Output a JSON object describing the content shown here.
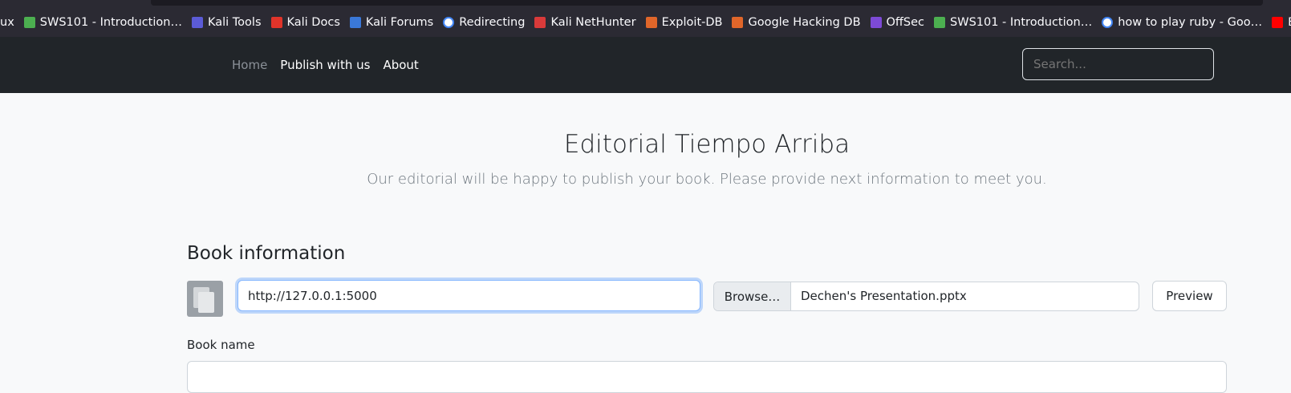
{
  "bookmarks": [
    {
      "label": "ux",
      "icon": "linux-icon",
      "color": "#2b2a33"
    },
    {
      "label": "SWS101 - Introduction…",
      "icon": "sws-icon",
      "color": "#4caf50"
    },
    {
      "label": "Kali Tools",
      "icon": "kali-tools-icon",
      "color": "#5b5bd6"
    },
    {
      "label": "Kali Docs",
      "icon": "kali-docs-icon",
      "color": "#e0342a"
    },
    {
      "label": "Kali Forums",
      "icon": "kali-forums-icon",
      "color": "#3a78d8"
    },
    {
      "label": "Redirecting",
      "icon": "google-icon",
      "color": "#ffffff"
    },
    {
      "label": "Kali NetHunter",
      "icon": "nethunter-icon",
      "color": "#d93a3a"
    },
    {
      "label": "Exploit-DB",
      "icon": "exploitdb-icon",
      "color": "#e0662a"
    },
    {
      "label": "Google Hacking DB",
      "icon": "ghdb-icon",
      "color": "#e0662a"
    },
    {
      "label": "OffSec",
      "icon": "offsec-icon",
      "color": "#7d4ad6"
    },
    {
      "label": "SWS101 - Introduction…",
      "icon": "sws-icon",
      "color": "#4caf50"
    },
    {
      "label": "how to play ruby - Goo…",
      "icon": "google-icon",
      "color": "#ffffff"
    },
    {
      "label": "Broken Access Co",
      "icon": "youtube-icon",
      "color": "#ff0000"
    }
  ],
  "nav": {
    "home": "Home",
    "publish": "Publish with us",
    "about": "About",
    "search_placeholder": "Search..."
  },
  "hero": {
    "title": "Editorial Tiempo Arriba",
    "subtitle": "Our editorial will be happy to publish your book. Please provide next information to meet you."
  },
  "book": {
    "section_title": "Book information",
    "url_value": "http://127.0.0.1:5000",
    "browse_label": "Browse…",
    "file_name": "Dechen's Presentation.pptx",
    "preview_label": "Preview",
    "name_label": "Book name"
  },
  "colors": {
    "navbar_bg": "#212529",
    "focus_border": "#86b7fe",
    "page_bg": "#f8f9fa"
  }
}
